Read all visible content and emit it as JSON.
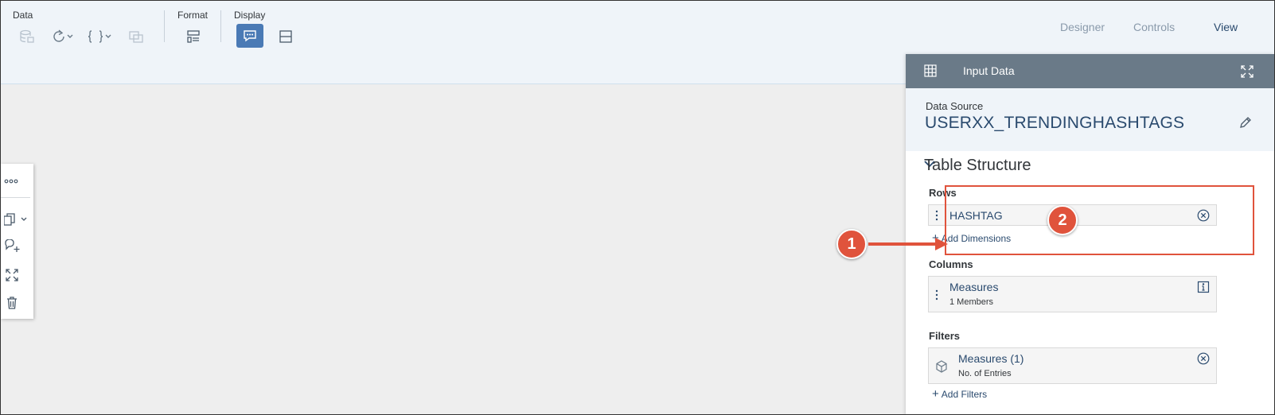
{
  "toolbar": {
    "groups": {
      "data": "Data",
      "format": "Format",
      "display": "Display"
    },
    "nav_tabs": [
      {
        "label": "Designer"
      },
      {
        "label": "Controls"
      },
      {
        "label": "View"
      }
    ],
    "accent_color": "#4a7ab5"
  },
  "panel": {
    "title": "Input Data",
    "data_source_label": "Data Source",
    "data_source_name": "USERXX_TRENDINGHASHTAGS",
    "section_title": "Table Structure",
    "rows": {
      "title": "Rows",
      "items": [
        {
          "label": "HASHTAG"
        }
      ],
      "add_label": "Add Dimensions"
    },
    "columns": {
      "title": "Columns",
      "items": [
        {
          "label": "Measures",
          "sub": "1 Members"
        }
      ]
    },
    "filters": {
      "title": "Filters",
      "items": [
        {
          "label": "Measures (1)",
          "sub": "No. of Entries"
        }
      ],
      "add_label": "Add Filters"
    }
  },
  "annotations": {
    "badge_1": "1",
    "badge_2": "2",
    "color": "#e0533c"
  }
}
